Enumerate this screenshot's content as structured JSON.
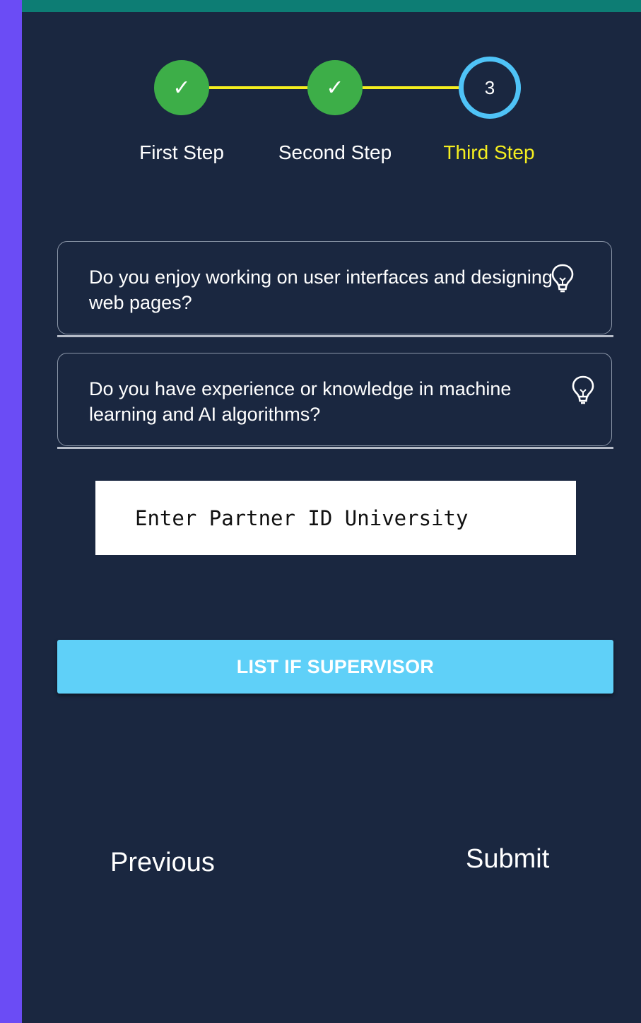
{
  "stepper": {
    "steps": [
      {
        "label": "First Step",
        "state": "completed",
        "icon": "✓"
      },
      {
        "label": "Second Step",
        "state": "completed",
        "icon": "✓"
      },
      {
        "label": "Third Step",
        "state": "active",
        "number": "3"
      }
    ]
  },
  "questions": [
    {
      "text": "Do you enjoy working on user interfaces and designing web pages?",
      "icon": "lightbulb-icon"
    },
    {
      "text": "Do you have experience or knowledge in machine learning and AI algorithms?",
      "icon": "lightbulb-icon"
    }
  ],
  "partner_input": {
    "placeholder": "Enter Partner ID University",
    "value": ""
  },
  "supervisor_button": {
    "label": "LIST IF SUPERVISOR"
  },
  "navigation": {
    "previous_label": "Previous",
    "submit_label": "Submit"
  },
  "colors": {
    "background": "#1a2740",
    "outer": "#6b4cf5",
    "top_bar": "#0d7d74",
    "completed": "#3dae48",
    "active_ring": "#4fc3f7",
    "active_label": "#f5ee1f",
    "connector": "#f5ee1f",
    "button": "#5fd0f8"
  }
}
